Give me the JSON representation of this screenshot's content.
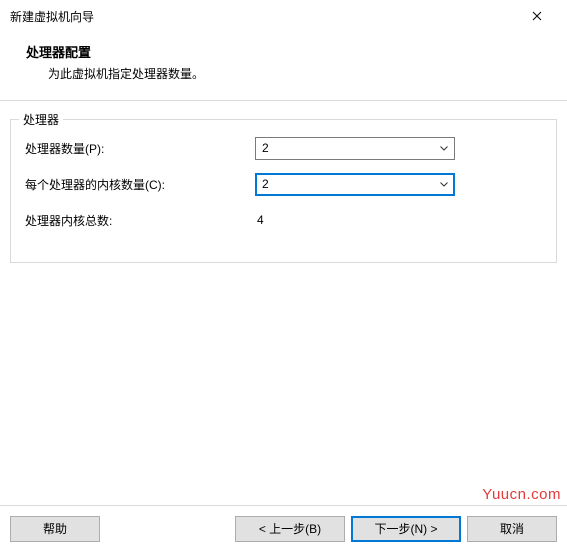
{
  "window": {
    "title": "新建虚拟机向导"
  },
  "header": {
    "title": "处理器配置",
    "subtitle": "为此虚拟机指定处理器数量。"
  },
  "group": {
    "legend": "处理器",
    "rows": {
      "proc_count": {
        "label": "处理器数量(P):",
        "value": "2"
      },
      "cores_per": {
        "label": "每个处理器的内核数量(C):",
        "value": "2"
      },
      "total": {
        "label": "处理器内核总数:",
        "value": "4"
      }
    }
  },
  "buttons": {
    "help": "帮助",
    "back": "< 上一步(B)",
    "next": "下一步(N) >",
    "cancel": "取消"
  },
  "watermark": "Yuucn.com"
}
